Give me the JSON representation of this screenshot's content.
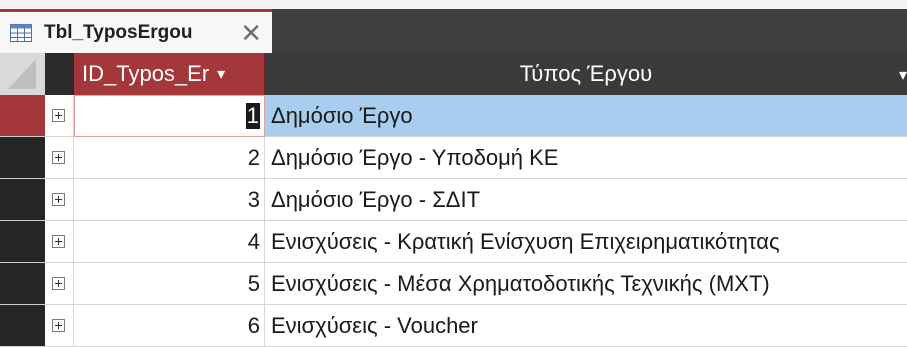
{
  "tab": {
    "title": "Tbl_TyposErgou",
    "icon": "table-icon",
    "close_icon": "close-icon",
    "close_glyph": "✕"
  },
  "columns": [
    {
      "label": "ID_Typos_Er",
      "sort_icon": "dropdown-arrow-icon",
      "sort_glyph": "▾"
    },
    {
      "label": "Τύπος Έργου",
      "sort_icon": "dropdown-arrow-icon",
      "sort_glyph": "▾"
    }
  ],
  "rows": [
    {
      "id": "1",
      "typos": "Δημόσιο Έργο"
    },
    {
      "id": "2",
      "typos": "Δημόσιο Έργο - Υποδομή ΚΕ"
    },
    {
      "id": "3",
      "typos": "Δημόσιο Έργο - ΣΔΙΤ"
    },
    {
      "id": "4",
      "typos": "Ενισχύσεις - Κρατική Ενίσχυση Επιχειρηματικότητας"
    },
    {
      "id": "5",
      "typos": "Ενισχύσεις - Μέσα Χρηματοδοτικής Τεχνικής (ΜΧΤ)"
    },
    {
      "id": "6",
      "typos": "Ενισχύσεις - Voucher"
    }
  ],
  "colors": {
    "accent": "#a4373a",
    "header_bg": "#3a3a3a",
    "selection": "#a9cdee"
  }
}
